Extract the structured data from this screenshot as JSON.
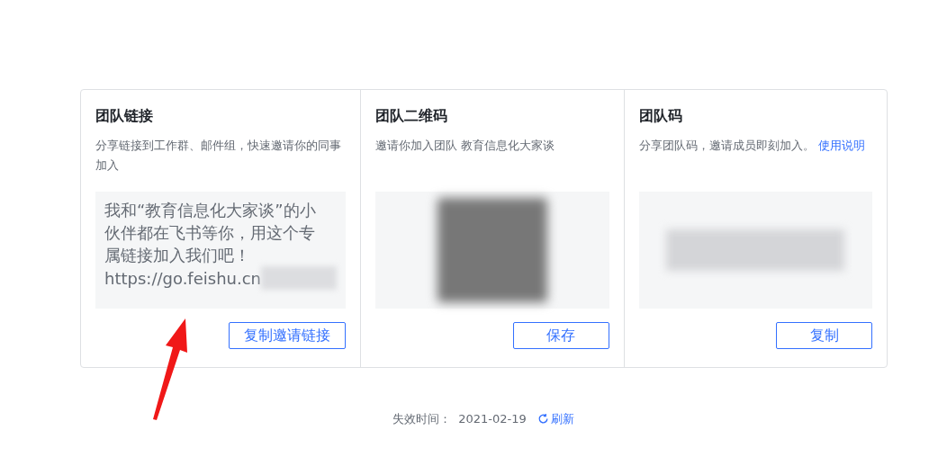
{
  "panels": [
    {
      "kind": "link",
      "title": "团队链接",
      "description": "分享链接到工作群、邮件组，快速邀请你的同事加入",
      "content": "我和“教育信息化大家谈”的小伙伴都在飞书等你，用这个专属链接加入我们吧！",
      "url": "https://go.feishu.cn",
      "button": "复制邀请链接"
    },
    {
      "kind": "qr",
      "title": "团队二维码",
      "description": "邀请你加入团队 教育信息化大家谈",
      "button": "保存"
    },
    {
      "kind": "code",
      "title": "团队码",
      "description": "分享团队码，邀请成员即刻加入。",
      "link": "使用说明",
      "button": "复制"
    }
  ],
  "footer": {
    "label": "失效时间：",
    "date": "2021-02-19",
    "refresh": "刷新"
  }
}
